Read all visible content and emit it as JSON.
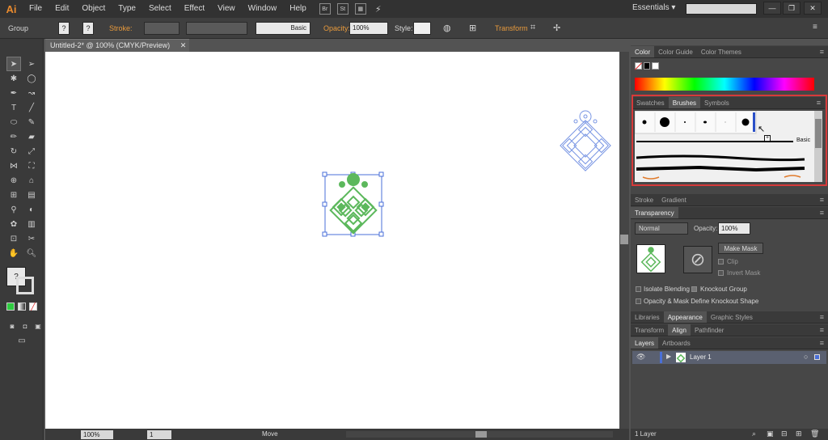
{
  "app": {
    "logo": "Ai"
  },
  "menu": [
    "File",
    "Edit",
    "Object",
    "Type",
    "Select",
    "Effect",
    "View",
    "Window",
    "Help"
  ],
  "menubar_icons": {
    "bridge": "Br",
    "stock": "St"
  },
  "workspace": {
    "label": "Essentials",
    "chevron": "▾"
  },
  "window_controls": {
    "minimize": "—",
    "restore": "❐",
    "close": "✕"
  },
  "control_bar": {
    "selection": "Group",
    "fill_q": "?",
    "stroke_q": "?",
    "stroke_label": "Stroke:",
    "brush_label": "Basic",
    "opacity_label": "Opacity:",
    "opacity_value": "100%",
    "style_label": "Style:",
    "transform_label": "Transform"
  },
  "document": {
    "tab_title": "Untitled-2* @ 100% (CMYK/Preview)",
    "close": "✕"
  },
  "status": {
    "zoom": "100%",
    "artboard": "1",
    "tool": "Move"
  },
  "panels": {
    "color_tabs": [
      "Color",
      "Color Guide",
      "Color Themes"
    ],
    "brush_tabs": [
      "Swatches",
      "Brushes",
      "Symbols"
    ],
    "brush_basic_label": "Basic",
    "stroke_tabs": [
      "Stroke",
      "Gradient"
    ],
    "transparency_tab": "Transparency",
    "blend_mode": "Normal",
    "opacity_label": "Opacity:",
    "opacity_value": "100%",
    "make_mask": "Make Mask",
    "clip": "Clip",
    "invert_mask": "Invert Mask",
    "isolate_blending": "Isolate Blending",
    "knockout_group": "Knockout Group",
    "opacity_mask_define": "Opacity & Mask Define Knockout Shape",
    "lib_tabs": [
      "Libraries",
      "Appearance",
      "Graphic Styles"
    ],
    "align_tabs": [
      "Transform",
      "Align",
      "Pathfinder"
    ],
    "layer_tabs": [
      "Layers",
      "Artboards"
    ],
    "layer_name": "Layer 1",
    "layer_count": "1 Layer"
  },
  "colors": {
    "art_green": "#5cb85c",
    "selection_blue": "#4a6fd8",
    "highlight_red": "#d63a3a"
  }
}
